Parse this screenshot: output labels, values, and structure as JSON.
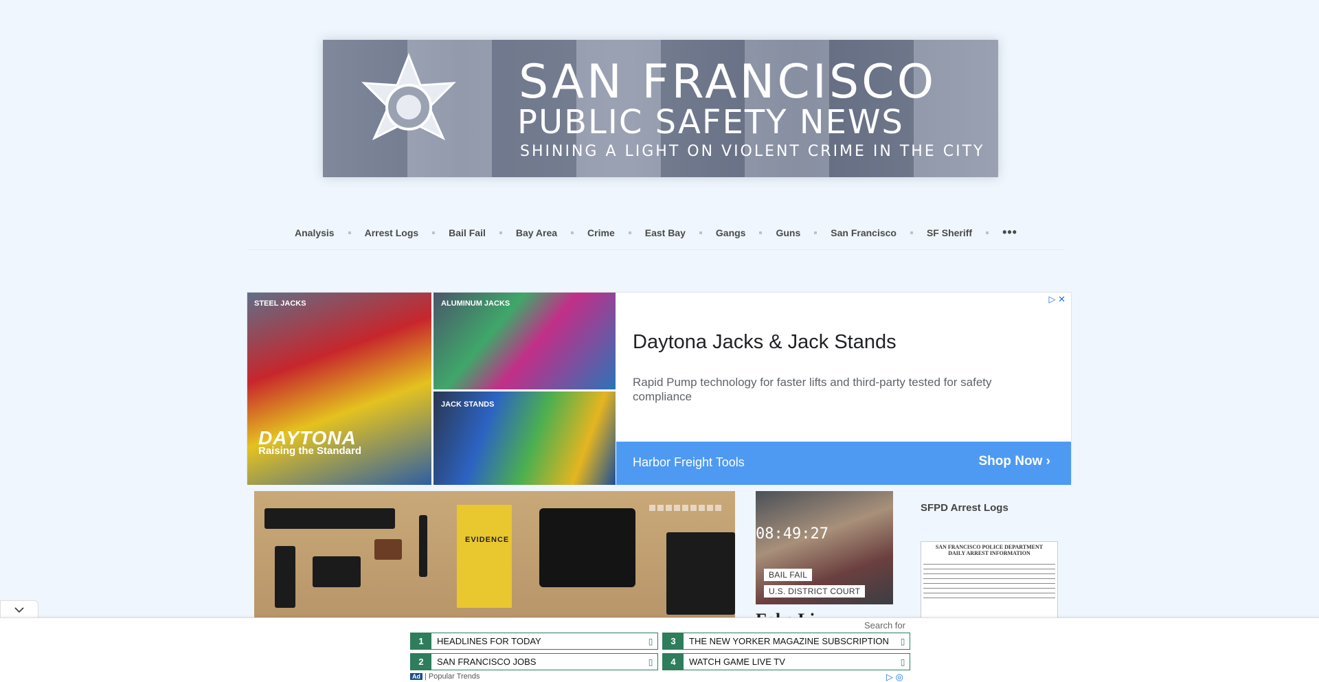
{
  "banner": {
    "title_line1": "SAN FRANCISCO",
    "title_line2": "PUBLIC SAFETY NEWS",
    "tagline": "SHINING A LIGHT ON VIOLENT CRIME IN THE CITY"
  },
  "nav": {
    "items": [
      {
        "label": "Analysis"
      },
      {
        "label": "Arrest Logs"
      },
      {
        "label": "Bail Fail"
      },
      {
        "label": "Bay Area"
      },
      {
        "label": "Crime"
      },
      {
        "label": "East Bay"
      },
      {
        "label": "Gangs"
      },
      {
        "label": "Guns"
      },
      {
        "label": "San Francisco"
      },
      {
        "label": "SF Sheriff"
      }
    ],
    "more_label": "•••"
  },
  "ad": {
    "label_steel": "STEEL JACKS",
    "label_aluminum": "ALUMINUM JACKS",
    "label_stands": "JACK STANDS",
    "brand": "DAYTONA",
    "brand_sub": "Raising the Standard",
    "title": "Daytona Jacks & Jack Stands",
    "description": "Rapid Pump technology for faster lifts and third-party tested for safety compliance",
    "advertiser": "Harbor Freight Tools",
    "cta": "Shop Now",
    "adchoices": "▷ ✕",
    "brand_color": "#4e9af3"
  },
  "hero": {
    "folder_text": "EVIDENCE"
  },
  "card2": {
    "timestamp": "08:49:27",
    "tag1": "BAIL FAIL",
    "tag2": "U.S. DISTRICT COURT",
    "title": "Fake Li"
  },
  "sidebar": {
    "title": "SFPD Arrest Logs",
    "doc_header_line1": "SAN FRANCISCO POLICE DEPARTMENT",
    "doc_header_line2": "DAILY ARREST INFORMATION"
  },
  "anchor_ad": {
    "search_for": "Search for",
    "links": [
      {
        "num": "1",
        "text": "HEADLINES FOR TODAY"
      },
      {
        "num": "2",
        "text": "SAN FRANCISCO JOBS"
      },
      {
        "num": "3",
        "text": "THE NEW YORKER MAGAZINE SUBSCRIPTION"
      },
      {
        "num": "4",
        "text": "WATCH GAME LIVE TV"
      }
    ],
    "ad_badge": "Ad",
    "footer": "| Popular Trends",
    "accent_color": "#2e7d5b"
  }
}
